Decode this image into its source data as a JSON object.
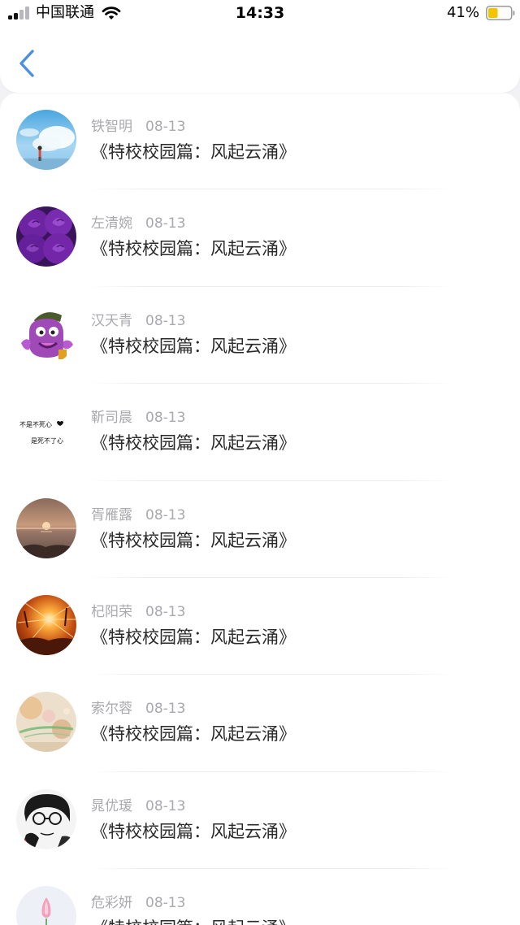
{
  "status_bar": {
    "carrier": "中国联通",
    "time": "14:33",
    "battery": "41%"
  },
  "header": {
    "back_icon": "chevron-left-icon"
  },
  "items": [
    {
      "name": "铁智明",
      "date": "08-13",
      "title": "《特校校园篇：风起云涌》"
    },
    {
      "name": "左清婉",
      "date": "08-13",
      "title": "《特校校园篇：风起云涌》"
    },
    {
      "name": "汉天青",
      "date": "08-13",
      "title": "《特校校园篇：风起云涌》"
    },
    {
      "name": "靳司晨",
      "date": "08-13",
      "title": "《特校校园篇：风起云涌》"
    },
    {
      "name": "胥雁露",
      "date": "08-13",
      "title": "《特校校园篇：风起云涌》"
    },
    {
      "name": "杞阳荣",
      "date": "08-13",
      "title": "《特校校园篇：风起云涌》"
    },
    {
      "name": "索尔蓉",
      "date": "08-13",
      "title": "《特校校园篇：风起云涌》"
    },
    {
      "name": "晁优瑗",
      "date": "08-13",
      "title": "《特校校园篇：风起云涌》"
    },
    {
      "name": "危彩妍",
      "date": "08-13",
      "title": "《特校校园篇：风起云涌》"
    }
  ],
  "avatar_4_text": [
    "不是不死心",
    "是死不了心"
  ],
  "colors": {
    "accent": "#4a90e2",
    "battery_fill": "#f5c400",
    "name_text": "#a9a9ae",
    "title_text": "#2a2a2a"
  }
}
